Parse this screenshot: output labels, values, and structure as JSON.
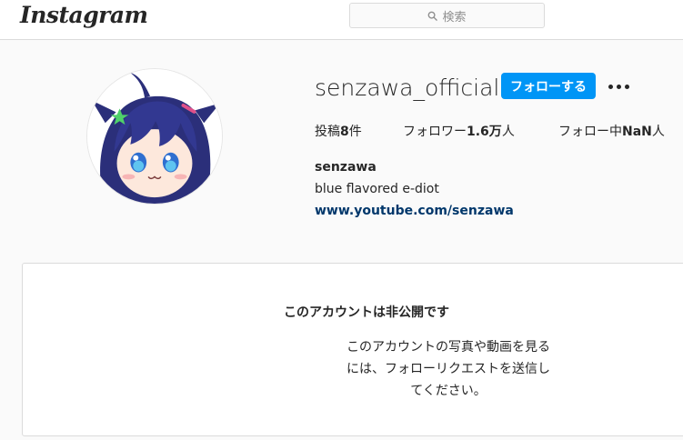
{
  "header": {
    "logo": "Instagram",
    "search": {
      "placeholder": "検索",
      "icon": "search-icon"
    }
  },
  "profile": {
    "username": "senzawa_official",
    "follow_label": "フォローする",
    "more_icon": "more-options-icon",
    "stats": {
      "posts_label": "投稿",
      "posts_value": "8",
      "posts_unit": "件",
      "followers_label": "フォロワー",
      "followers_value": "1.6万",
      "followers_unit": "人",
      "following_label": "フォロー中",
      "following_value": "NaN",
      "following_unit": "人"
    },
    "full_name": "senzawa",
    "bio": "blue flavored e-diot",
    "link": "www.youtube.com/senzawa"
  },
  "private_notice": {
    "title": "このアカウントは非公開です",
    "line1": "このアカウントの写真や動画を見る",
    "line2": "には、フォローリクエストを送信し",
    "line3": "てください。"
  },
  "colors": {
    "accent": "#0095f6",
    "link": "#00376b",
    "border": "#dbdbdb",
    "background": "#fafafa"
  }
}
